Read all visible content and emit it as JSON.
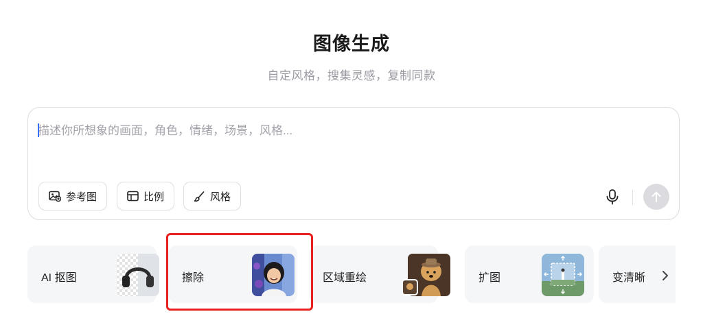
{
  "header": {
    "title": "图像生成",
    "subtitle": "自定风格，搜集灵感，复制同款"
  },
  "prompt": {
    "placeholder": "描述你所想象的画面，角色，情绪，场景，风格...",
    "tools": [
      {
        "label": "参考图",
        "icon": "image-plus-icon"
      },
      {
        "label": "比例",
        "icon": "aspect-ratio-icon"
      },
      {
        "label": "风格",
        "icon": "brush-icon"
      }
    ],
    "mic_icon": "microphone-icon",
    "send_icon": "arrow-up-icon"
  },
  "cards": [
    {
      "label": "AI 抠图",
      "thumb": "headphones-cutout"
    },
    {
      "label": "擦除",
      "thumb": "child-portrait"
    },
    {
      "label": "区域重绘",
      "thumb": "dog-with-hat"
    },
    {
      "label": "扩图",
      "thumb": "landscape-expand"
    },
    {
      "label": "变清晰",
      "thumb": ""
    }
  ],
  "colors": {
    "highlight": "#e8201f",
    "card_bg": "#f5f6f8",
    "caret": "#3b6cf6"
  }
}
